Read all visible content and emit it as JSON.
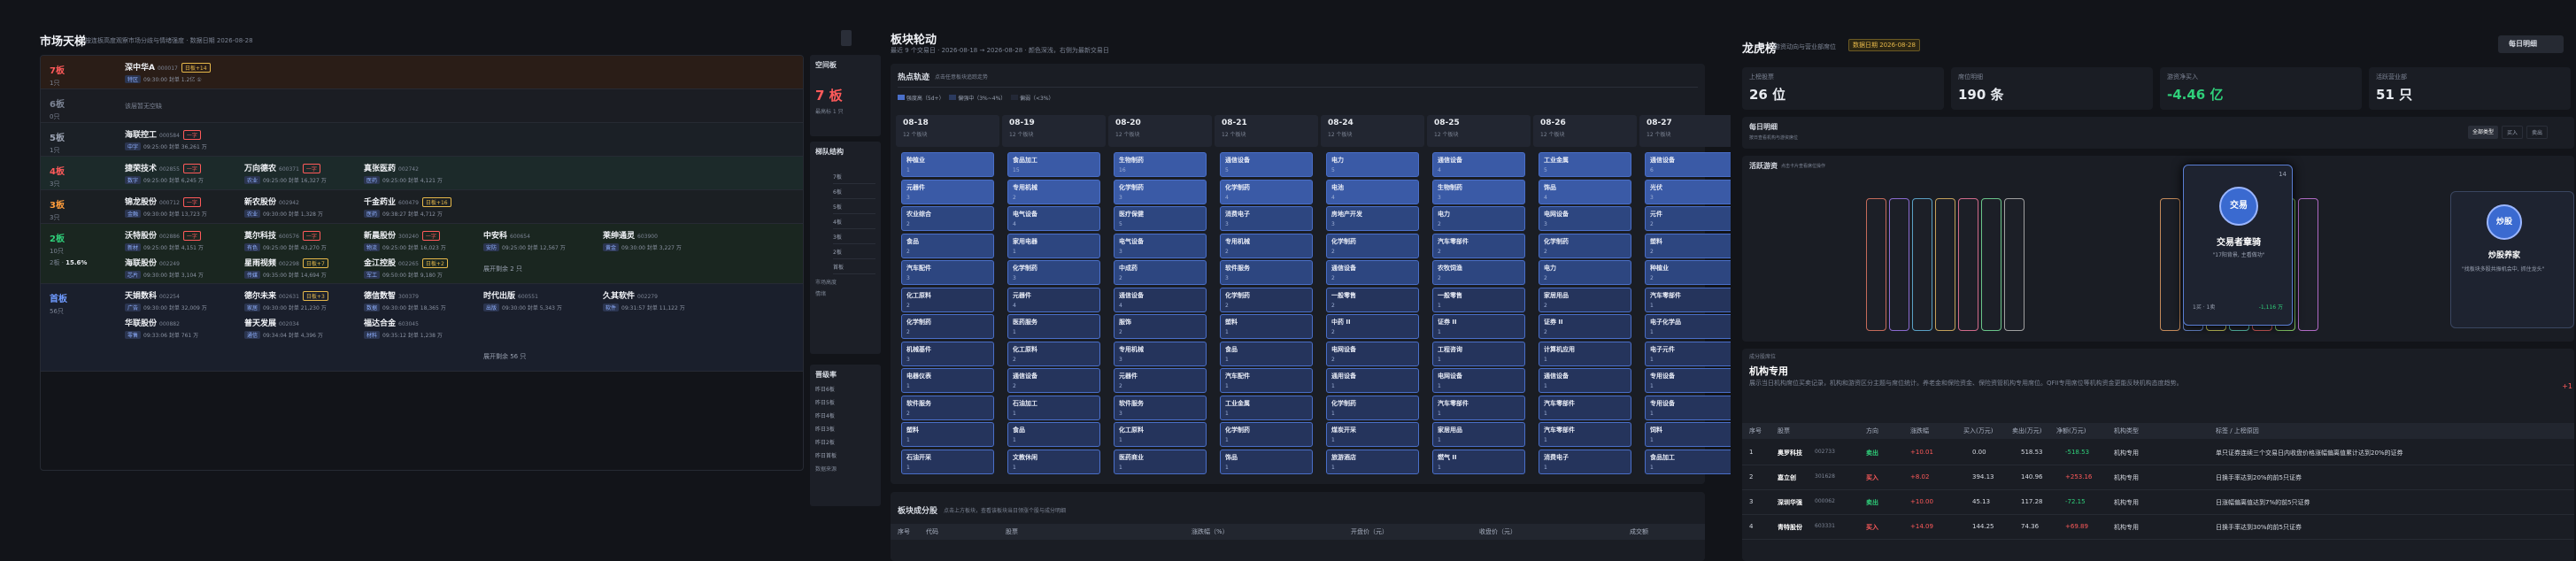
{
  "p1": {
    "title": "市场天梯",
    "subtitle": "按连板高度观察市场分歧与情绪强度 · 数据日期 2026-08-28",
    "levels": [
      {
        "name": "7板",
        "count": "1只",
        "rate": "7板",
        "pct": "100.0%",
        "stocks": [
          {
            "name": "深中华A",
            "code": "000017",
            "tag": "日板+14",
            "tagc": "gold",
            "line": "09:30:00",
            "sub": "封单 1.2亿 ①",
            "chip": "特区"
          }
        ],
        "bg": "#2a1d17"
      },
      {
        "name": "6板",
        "count": "0只",
        "empty": "该层暂无空缺",
        "bg": "#1b1d23"
      },
      {
        "name": "5板",
        "count": "1只",
        "rate": "5板",
        "pct": "33.3%",
        "stocks": [
          {
            "name": "海联控工",
            "code": "000584",
            "tag": "一字",
            "tagc": "red",
            "line": "09:25:00",
            "sub": "封单 36,261 万",
            "chip": "中字"
          }
        ],
        "bg": "#1b2026"
      },
      {
        "name": "4板",
        "count": "3只",
        "rate": "4板",
        "pct": "100.0%",
        "stocks": [
          {
            "name": "捷荣技术",
            "code": "002855",
            "tag": "一字",
            "tagc": "red",
            "line": "09:25:00",
            "sub": "封单 6,245 万",
            "chip": "数字"
          },
          {
            "name": "万向德农",
            "code": "600371",
            "tag": "一字",
            "tagc": "red",
            "line": "09:25:00",
            "sub": "封单 16,327 万",
            "chip": "农业"
          },
          {
            "name": "真张医药",
            "code": "002742",
            "tag": "",
            "line": "09:25:00",
            "sub": "封单 4,121 万",
            "chip": "医药"
          }
        ],
        "bg": "#1c2a2a"
      },
      {
        "name": "3板",
        "count": "3只",
        "rate": "3板",
        "pct": "30.0%",
        "stocks": [
          {
            "name": "锦龙股份",
            "code": "000712",
            "tag": "一字",
            "tagc": "red",
            "line": "09:30:00",
            "sub": "封单 13,723 万",
            "chip": "金融"
          },
          {
            "name": "新农股份",
            "code": "002942",
            "tag": "",
            "line": "09:30:00",
            "sub": "封单 1,328 万",
            "chip": "农业"
          },
          {
            "name": "千金药业",
            "code": "600479",
            "tag": "日板+16",
            "tagc": "gold",
            "line": "09:38:27",
            "sub": "封单 4,712 万",
            "chip": "医药"
          }
        ],
        "bg": "#1b1f23"
      },
      {
        "name": "2板",
        "count": "10只",
        "rate": "2板",
        "pct": "15.6%",
        "stocks": [
          {
            "name": "沃特股份",
            "code": "002886",
            "tag": "一字",
            "tagc": "red",
            "line": "09:25:00",
            "sub": "封单 4,151 万",
            "chip": "新材"
          },
          {
            "name": "莫尔科技",
            "code": "600576",
            "tag": "一字",
            "tagc": "red",
            "line": "09:25:00",
            "sub": "封单 43,270 万",
            "chip": "有色"
          },
          {
            "name": "新晨股份",
            "code": "300240",
            "tag": "一字",
            "tagc": "red",
            "line": "09:25:00",
            "sub": "封单 16,023 万",
            "chip": "物流"
          },
          {
            "name": "中安科",
            "code": "600654",
            "tag": "",
            "line": "09:25:00",
            "sub": "封单 12,567 万",
            "chip": "安防"
          },
          {
            "name": "莱绅通灵",
            "code": "603900",
            "tag": "",
            "line": "09:30:00",
            "sub": "封单 3,227 万",
            "chip": "黄金"
          },
          {
            "name": "海联股份",
            "code": "002249",
            "tag": "",
            "line": "09:30:00",
            "sub": "封单 3,104 万",
            "chip": "芯片"
          },
          {
            "name": "星雨视频",
            "code": "002298",
            "tag": "日板+7",
            "tagc": "gold",
            "line": "09:35:00",
            "sub": "封单 14,694 万",
            "chip": "传媒"
          },
          {
            "name": "金江控股",
            "code": "002265",
            "tag": "日板+2",
            "tagc": "gold",
            "line": "09:50:00",
            "sub": "封单 9,180 万",
            "chip": "军工"
          }
        ],
        "more": "展开剩余 2 只",
        "bg": "#1a2620"
      },
      {
        "name": "首板",
        "count": "56只",
        "stocks": [
          {
            "name": "天娟数科",
            "code": "002254",
            "tag": "",
            "line": "09:30:00",
            "sub": "封单 32,009 万",
            "chip": "广告"
          },
          {
            "name": "德尔未来",
            "code": "002631",
            "tag": "日板+3",
            "tagc": "gold",
            "line": "09:30:00",
            "sub": "封单 21,230 万",
            "chip": "家居"
          },
          {
            "name": "德信数智",
            "code": "300379",
            "tag": "",
            "line": "09:30:00",
            "sub": "封单 18,365 万",
            "chip": "数据"
          },
          {
            "name": "时代出版",
            "code": "600551",
            "tag": "",
            "line": "09:30:00",
            "sub": "封单 5,343 万",
            "chip": "出版"
          },
          {
            "name": "久其软件",
            "code": "002279",
            "tag": "",
            "line": "09:31:57",
            "sub": "封单 11,122 万",
            "chip": "软件"
          },
          {
            "name": "华联股份",
            "code": "000882",
            "tag": "",
            "line": "09:33:06",
            "sub": "封单 761 万",
            "chip": "零售"
          },
          {
            "name": "普天发展",
            "code": "002034",
            "tag": "",
            "line": "09:34:04",
            "sub": "封单 4,396 万",
            "chip": "通信"
          },
          {
            "name": "福达合金",
            "code": "603045",
            "tag": "",
            "line": "09:35:12",
            "sub": "封单 1,238 万",
            "chip": "材料"
          }
        ],
        "more": "展开剩余 56 只",
        "bg": "#1a1f2c"
      }
    ],
    "side": {
      "t1": "空间板",
      "big": "7 板",
      "s1": "最高标 1 只",
      "t2": "梯队结构",
      "rows": [
        "7板",
        "6板",
        "5板",
        "4板",
        "3板",
        "2板",
        "首板"
      ],
      "s2": "市场高度",
      "s3": "情绪",
      "t3": "晋级率",
      "rows3": [
        "昨日6板",
        "昨日5板",
        "昨日4板",
        "昨日3板",
        "昨日2板",
        "昨日首板"
      ],
      "s4": "数据来源"
    }
  },
  "p2": {
    "title": "板块轮动",
    "subtitle": "最近 9 个交易日 · 2026-08-18 → 2026-08-28 · 颜色深浅，右侧为最新交易日",
    "section": "热点轨迹",
    "section_sub": "点击任意板块追踪走势",
    "legend": [
      "强度高（5d+）",
      "偏强中（3%~4%）",
      "偏弱（<3%）"
    ],
    "cols": [
      {
        "date": "08-18",
        "cnt": "12 个板块",
        "tiles": [
          {
            "n": "种植业",
            "v": "1"
          },
          {
            "n": "元器件",
            "v": "3"
          },
          {
            "n": "农业综合",
            "v": "2"
          },
          {
            "n": "食品",
            "v": "2"
          },
          {
            "n": "汽车配件",
            "v": "3"
          },
          {
            "n": "化工原料",
            "v": "2"
          },
          {
            "n": "化学制药",
            "v": "2"
          },
          {
            "n": "机械基件",
            "v": "3"
          },
          {
            "n": "电器仪表",
            "v": "1"
          },
          {
            "n": "软件服务",
            "v": "2"
          },
          {
            "n": "塑料",
            "v": "1"
          },
          {
            "n": "石油开采",
            "v": "1"
          }
        ]
      },
      {
        "date": "08-19",
        "cnt": "12 个板块",
        "tiles": [
          {
            "n": "食品加工",
            "v": "15"
          },
          {
            "n": "专用机械",
            "v": "2"
          },
          {
            "n": "电气设备",
            "v": "4"
          },
          {
            "n": "家用电器",
            "v": "1"
          },
          {
            "n": "化学制药",
            "v": "3"
          },
          {
            "n": "元器件",
            "v": "4"
          },
          {
            "n": "医药服务",
            "v": "1"
          },
          {
            "n": "化工原料",
            "v": "2"
          },
          {
            "n": "通信设备",
            "v": "2"
          },
          {
            "n": "石油加工",
            "v": "1"
          },
          {
            "n": "食品",
            "v": "1"
          },
          {
            "n": "文教休闲",
            "v": "1"
          }
        ]
      },
      {
        "date": "08-20",
        "cnt": "12 个板块",
        "tiles": [
          {
            "n": "生物制药",
            "v": "16"
          },
          {
            "n": "化学制药",
            "v": "3"
          },
          {
            "n": "医疗保健",
            "v": "5"
          },
          {
            "n": "电气设备",
            "v": "3"
          },
          {
            "n": "中成药",
            "v": "2"
          },
          {
            "n": "通信设备",
            "v": "4"
          },
          {
            "n": "服饰",
            "v": "2"
          },
          {
            "n": "专用机械",
            "v": "3"
          },
          {
            "n": "元器件",
            "v": "2"
          },
          {
            "n": "软件服务",
            "v": "3"
          },
          {
            "n": "化工原料",
            "v": "1"
          },
          {
            "n": "医药商业",
            "v": "1"
          }
        ]
      },
      {
        "date": "08-21",
        "cnt": "12 个板块",
        "tiles": [
          {
            "n": "通信设备",
            "v": "5"
          },
          {
            "n": "化学制药",
            "v": "4"
          },
          {
            "n": "消费电子",
            "v": "3"
          },
          {
            "n": "专用机械",
            "v": "2"
          },
          {
            "n": "软件服务",
            "v": "3"
          },
          {
            "n": "化学制药",
            "v": "2"
          },
          {
            "n": "塑料",
            "v": "1"
          },
          {
            "n": "食品",
            "v": "1"
          },
          {
            "n": "汽车配件",
            "v": "1"
          },
          {
            "n": "工业金属",
            "v": "1"
          },
          {
            "n": "化学制药",
            "v": "1"
          },
          {
            "n": "饰品",
            "v": "1"
          }
        ]
      },
      {
        "date": "08-24",
        "cnt": "12 个板块",
        "tiles": [
          {
            "n": "电力",
            "v": "5"
          },
          {
            "n": "电池",
            "v": "4"
          },
          {
            "n": "房地产开发",
            "v": "3"
          },
          {
            "n": "化学制药",
            "v": "2"
          },
          {
            "n": "通信设备",
            "v": "2"
          },
          {
            "n": "一般零售",
            "v": "2"
          },
          {
            "n": "中药 II",
            "v": "2"
          },
          {
            "n": "电网设备",
            "v": "2"
          },
          {
            "n": "通用设备",
            "v": "1"
          },
          {
            "n": "化学制药",
            "v": "1"
          },
          {
            "n": "煤炭开采",
            "v": "1"
          },
          {
            "n": "旅游酒店",
            "v": "1"
          }
        ]
      },
      {
        "date": "08-25",
        "cnt": "12 个板块",
        "tiles": [
          {
            "n": "通信设备",
            "v": "4"
          },
          {
            "n": "生物制药",
            "v": "3"
          },
          {
            "n": "电力",
            "v": "2"
          },
          {
            "n": "汽车零部件",
            "v": "2"
          },
          {
            "n": "农牧饲渔",
            "v": "2"
          },
          {
            "n": "一般零售",
            "v": "1"
          },
          {
            "n": "证券 II",
            "v": "1"
          },
          {
            "n": "工程咨询",
            "v": "1"
          },
          {
            "n": "电网设备",
            "v": "1"
          },
          {
            "n": "汽车零部件",
            "v": "1"
          },
          {
            "n": "家居用品",
            "v": "1"
          },
          {
            "n": "燃气 II",
            "v": "1"
          }
        ]
      },
      {
        "date": "08-26",
        "cnt": "12 个板块",
        "tiles": [
          {
            "n": "工业金属",
            "v": "5"
          },
          {
            "n": "饰品",
            "v": "4"
          },
          {
            "n": "电网设备",
            "v": "3"
          },
          {
            "n": "化学制药",
            "v": "2"
          },
          {
            "n": "电力",
            "v": "2"
          },
          {
            "n": "家居用品",
            "v": "2"
          },
          {
            "n": "证券 II",
            "v": "2"
          },
          {
            "n": "计算机应用",
            "v": "1"
          },
          {
            "n": "通信设备",
            "v": "1"
          },
          {
            "n": "汽车零部件",
            "v": "1"
          },
          {
            "n": "汽车零部件",
            "v": "1"
          },
          {
            "n": "消费电子",
            "v": "1"
          }
        ]
      },
      {
        "date": "08-27",
        "cnt": "12 个板块",
        "tiles": [
          {
            "n": "通信设备",
            "v": "6"
          },
          {
            "n": "光伏",
            "v": "3"
          },
          {
            "n": "元件",
            "v": "2"
          },
          {
            "n": "塑料",
            "v": "2"
          },
          {
            "n": "种植业",
            "v": "2"
          },
          {
            "n": "汽车零部件",
            "v": "1"
          },
          {
            "n": "电子化学品",
            "v": "1"
          },
          {
            "n": "电子元件",
            "v": "1"
          },
          {
            "n": "专用设备",
            "v": "1"
          },
          {
            "n": "专用设备",
            "v": "1"
          },
          {
            "n": "饲料",
            "v": "1"
          },
          {
            "n": "食品加工",
            "v": "1"
          }
        ]
      }
    ],
    "table_title": "板块成分股",
    "table_sub": "点击上方板块，查看该板块当日领涨个股与成分明细",
    "headers": [
      "序号",
      "代码",
      "股票",
      "涨跌幅（%）",
      "开盘价（元）",
      "收盘价（元）",
      "成交额"
    ]
  },
  "p3": {
    "title": "龙虎榜",
    "subtitle": "游资动向与营业部席位",
    "date_badge": "数据日期 2026-08-28",
    "btn": "每日明细",
    "stats": [
      {
        "label": "上榜股票",
        "value": "26 位"
      },
      {
        "label": "席位明细",
        "value": "190 条"
      },
      {
        "label": "游资净买入",
        "value": "-4.46 亿"
      },
      {
        "label": "活跃营业部",
        "value": "51 只"
      }
    ],
    "sec1": "每日明细",
    "sec1_sub": "按日查看机构与游资席位",
    "filters": [
      "全部类型",
      "买入",
      "卖出"
    ],
    "sec2": "活跃游资",
    "sec2_sub": "点击卡片查看席位操作",
    "hl1": {
      "name": "交易者章骑",
      "tag": "交易",
      "line": "\"17阳背景, 主看做功\"",
      "foot1": "1买 · 1卖",
      "foot2": "-1,116 万",
      "num": "14"
    },
    "hl2": {
      "name": "炒股养家",
      "tag": "炒股",
      "line": "\"找板块多股共振机会中, 抓住龙头\""
    },
    "sec3": "机构专用",
    "sec3_sub": "成分股席位",
    "desc": "展示当日机构席位买卖记录，机构和游资区分主题与席位统计。养老金和保险资金、保险资管机构专用席位。QFII专用席位等机构资金更能反映机构态度趋势。",
    "hdr": [
      "序号",
      "股票",
      "方向",
      "涨跌幅",
      "买入(万元)",
      "卖出(万元)",
      "净额(万元)",
      "机构类型",
      "标签 / 上榜原因"
    ],
    "rows": [
      {
        "i": "1",
        "n": "奥罗科技",
        "c": "002733",
        "d": "卖出",
        "chg": "+10.01",
        "b": "0.00",
        "s": "518.53",
        "net": "-518.53",
        "t": "机构专用",
        "r": "单只证券连续三个交易日内收盘价格涨幅偏离值累计达到20%的证券"
      },
      {
        "i": "2",
        "n": "嘉立创",
        "c": "301628",
        "d": "买入",
        "chg": "+8.02",
        "b": "394.13",
        "s": "140.96",
        "net": "+253.16",
        "t": "机构专用",
        "r": "日换手率达到20%的前5只证券"
      },
      {
        "i": "3",
        "n": "深圳华强",
        "c": "000062",
        "d": "卖出",
        "chg": "+10.00",
        "b": "45.13",
        "s": "117.28",
        "net": "-72.15",
        "t": "机构专用",
        "r": "日涨幅偏离值达到7%的前5只证券"
      },
      {
        "i": "4",
        "n": "青特股份",
        "c": "603331",
        "d": "买入",
        "chg": "+14.09",
        "b": "144.25",
        "s": "74.36",
        "net": "+69.89",
        "t": "机构专用",
        "r": "日换手率达到30%的前5只证券"
      }
    ],
    "side_num": "+1"
  }
}
